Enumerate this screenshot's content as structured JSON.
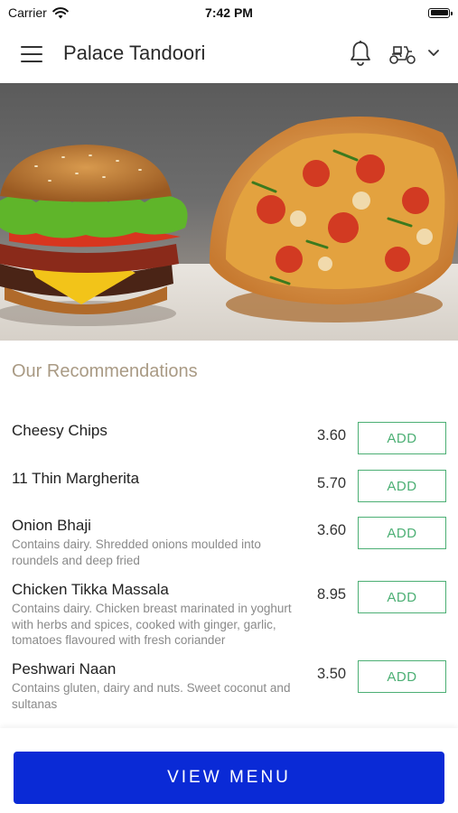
{
  "status_bar": {
    "carrier": "Carrier",
    "time": "7:42 PM"
  },
  "header": {
    "title": "Palace Tandoori",
    "icons": [
      "menu-icon",
      "bell-icon",
      "scooter-icon",
      "chevron-down-icon"
    ]
  },
  "hero": {
    "image": "burger-and-pizza-photo"
  },
  "recommendations": {
    "title": "Our Recommendations",
    "add_label": "ADD",
    "items": [
      {
        "name": "Cheesy Chips",
        "description": "",
        "price": "3.60"
      },
      {
        "name": "11 Thin Margherita",
        "description": "",
        "price": "5.70"
      },
      {
        "name": "Onion Bhaji",
        "description": "Contains dairy. Shredded onions moulded into roundels and deep fried",
        "price": "3.60"
      },
      {
        "name": "Chicken Tikka Massala",
        "description": "Contains dairy. Chicken breast marinated in yoghurt with herbs and spices, cooked with ginger, garlic, tomatoes flavoured with fresh coriander",
        "price": "8.95"
      },
      {
        "name": "Peshwari Naan",
        "description": "Contains gluten, dairy and nuts. Sweet coconut and sultanas",
        "price": "3.50"
      }
    ]
  },
  "footer": {
    "view_menu_label": "VIEW MENU"
  },
  "colors": {
    "accent": "#0a2ad6",
    "add_green": "#4caf74",
    "section_title": "#a99a84"
  }
}
